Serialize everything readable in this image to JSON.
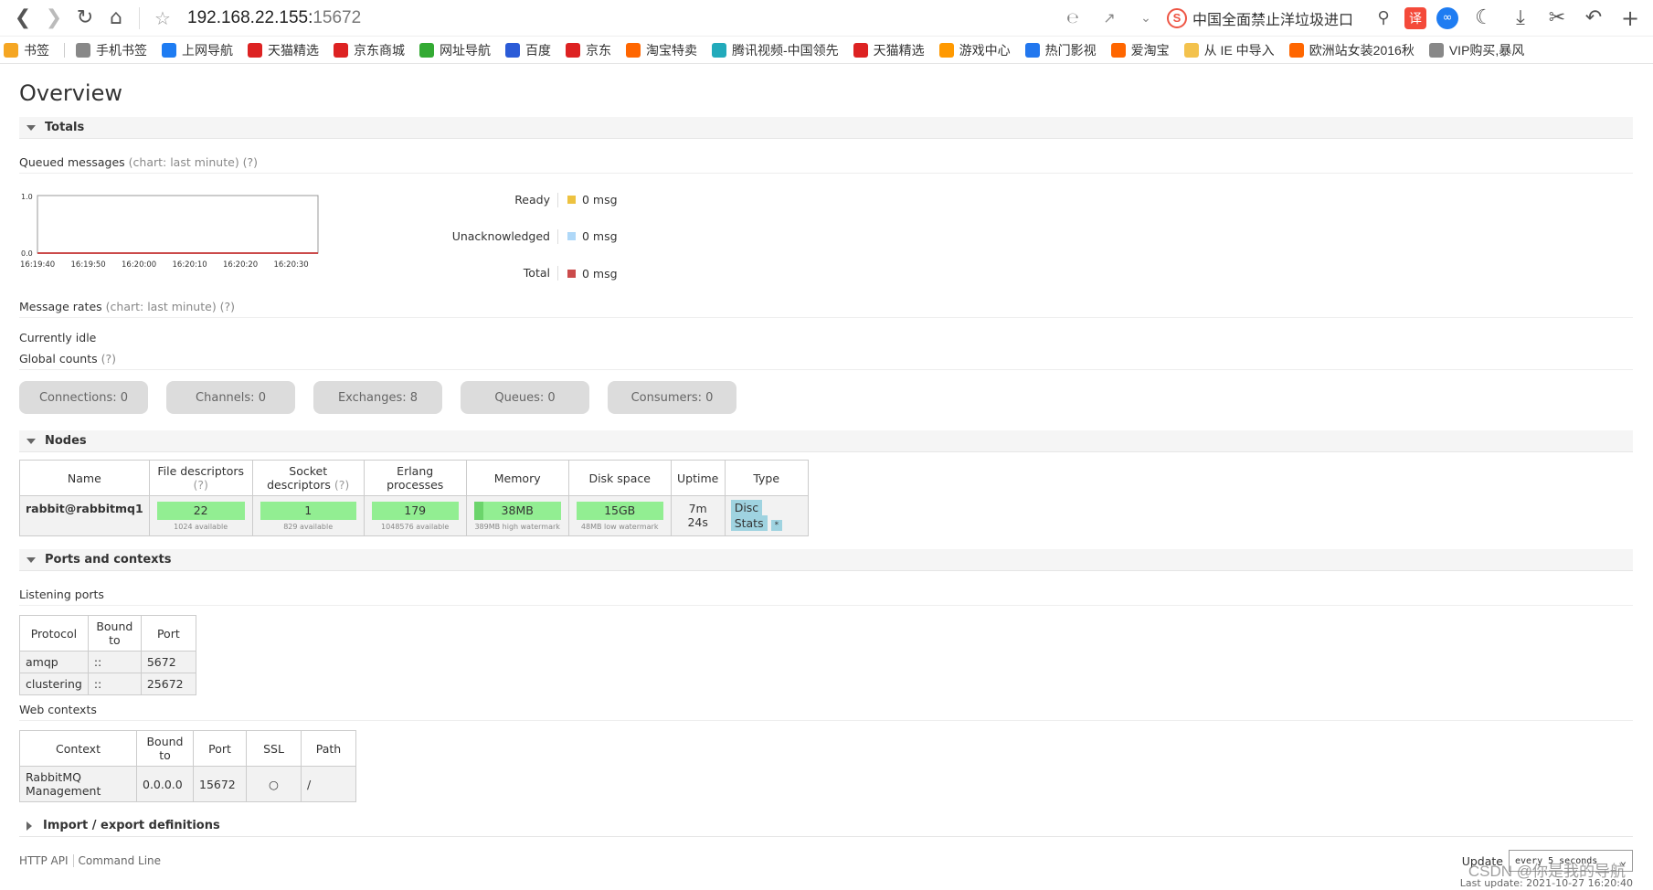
{
  "browser": {
    "url_host": "192.168.22.155:",
    "url_port": "15672",
    "news": "中国全面禁止洋垃圾进口",
    "translate_badge": "译"
  },
  "bookmarks": [
    {
      "label": "书签",
      "icon": "star-icon",
      "color": "#f5a623"
    },
    {
      "label": "手机书签",
      "icon": "phone-icon",
      "color": "#888888"
    },
    {
      "label": "上网导航",
      "icon": "ie-icon",
      "color": "#1e7cf2"
    },
    {
      "label": "天猫精选",
      "icon": "tmall-icon",
      "color": "#d22"
    },
    {
      "label": "京东商城",
      "icon": "jd-icon",
      "color": "#d22"
    },
    {
      "label": "网址导航",
      "icon": "hao-icon",
      "color": "#3a3"
    },
    {
      "label": "百度",
      "icon": "baidu-icon",
      "color": "#2b5bd7"
    },
    {
      "label": "京东",
      "icon": "jd-icon",
      "color": "#d22"
    },
    {
      "label": "淘宝特卖",
      "icon": "taobao-icon",
      "color": "#f60"
    },
    {
      "label": "腾讯视频-中国领先",
      "icon": "tencent-video-icon",
      "color": "#2ab"
    },
    {
      "label": "天猫精选",
      "icon": "tmall-icon",
      "color": "#d22"
    },
    {
      "label": "游戏中心",
      "icon": "game-icon",
      "color": "#f90"
    },
    {
      "label": "热门影视",
      "icon": "video-icon",
      "color": "#27e"
    },
    {
      "label": "爱淘宝",
      "icon": "taobao-icon",
      "color": "#f60"
    },
    {
      "label": "从 IE 中导入",
      "icon": "folder-icon",
      "color": "#f3c24d"
    },
    {
      "label": "欧洲站女装2016秋",
      "icon": "taobao-icon",
      "color": "#f60"
    },
    {
      "label": "VIP购买,暴风",
      "icon": "vip-icon",
      "color": "#888888"
    }
  ],
  "page": {
    "title": "Overview",
    "totals_label": "Totals",
    "queued_label": "Queued messages",
    "queued_hint": "(chart: last minute) (?)",
    "rates_label": "Message rates",
    "rates_hint": "(chart: last minute) (?)",
    "idle": "Currently idle",
    "global_label": "Global counts",
    "global_hint": "(?)",
    "nodes_label": "Nodes",
    "ports_label": "Ports and contexts",
    "listening_label": "Listening ports",
    "web_label": "Web contexts",
    "import_label": "Import / export definitions"
  },
  "chart_data": {
    "type": "area",
    "title": "",
    "x": [
      "16:19:40",
      "16:19:50",
      "16:20:00",
      "16:20:10",
      "16:20:20",
      "16:20:30"
    ],
    "ylim": [
      0.0,
      1.0
    ],
    "yticks": [
      "1.0",
      "0.0"
    ],
    "series": [
      {
        "name": "Ready",
        "values": [
          0,
          0,
          0,
          0,
          0,
          0
        ],
        "color": "#edc240"
      },
      {
        "name": "Unacknowledged",
        "values": [
          0,
          0,
          0,
          0,
          0,
          0
        ],
        "color": "#afd8f8"
      },
      {
        "name": "Total",
        "values": [
          0,
          0,
          0,
          0,
          0,
          0
        ],
        "color": "#cb4b4b"
      }
    ]
  },
  "legend": [
    {
      "label": "Ready",
      "value": "0 msg",
      "color": "#edc240"
    },
    {
      "label": "Unacknowledged",
      "value": "0 msg",
      "color": "#afd8f8"
    },
    {
      "label": "Total",
      "value": "0 msg",
      "color": "#cb4b4b"
    }
  ],
  "counts": [
    {
      "label": "Connections: 0"
    },
    {
      "label": "Channels: 0"
    },
    {
      "label": "Exchanges: 8"
    },
    {
      "label": "Queues: 0"
    },
    {
      "label": "Consumers: 0"
    }
  ],
  "nodes": {
    "headers": [
      "Name",
      "File descriptors",
      "Socket descriptors",
      "Erlang processes",
      "Memory",
      "Disk space",
      "Uptime",
      "Type"
    ],
    "hint": "(?)",
    "row": {
      "name": "rabbit@rabbitmq1",
      "fd": "22",
      "fd_sub": "1024 available",
      "sd": "1",
      "sd_sub": "829 available",
      "ep": "179",
      "ep_sub": "1048576 available",
      "mem": "38MB",
      "mem_sub": "389MB high watermark",
      "disk": "15GB",
      "disk_sub": "48MB low watermark",
      "uptime": "7m 24s",
      "type_disc": "Disc",
      "type_stats": "Stats",
      "type_star": "*"
    }
  },
  "listening": {
    "headers": [
      "Protocol",
      "Bound to",
      "Port"
    ],
    "rows": [
      [
        "amqp",
        "::",
        "5672"
      ],
      [
        "clustering",
        "::",
        "25672"
      ]
    ]
  },
  "web": {
    "headers": [
      "Context",
      "Bound to",
      "Port",
      "SSL",
      "Path"
    ],
    "rows": [
      [
        "RabbitMQ Management",
        "0.0.0.0",
        "15672",
        "○",
        "/"
      ]
    ]
  },
  "footer": {
    "http_api": "HTTP API",
    "cli": "Command Line",
    "update_label": "Update",
    "update_value": "every 5 seconds",
    "last_update": "Last update: 2021-10-27 16:20:40",
    "watermark": "CSDN @你是我的导航"
  }
}
